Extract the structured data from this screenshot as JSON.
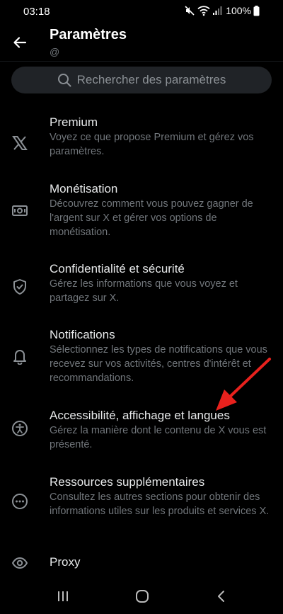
{
  "status_bar": {
    "time": "03:18",
    "battery": "100%"
  },
  "header": {
    "title": "Paramètres",
    "subtitle": "@"
  },
  "search": {
    "placeholder": "Rechercher des paramètres"
  },
  "settings": [
    {
      "icon": "x-logo-icon",
      "title": "Premium",
      "description": "Voyez ce que propose Premium et gérez vos paramètres."
    },
    {
      "icon": "money-icon",
      "title": "Monétisation",
      "description": "Découvrez comment vous pouvez gagner de l'argent sur X et gérer vos options de monétisation."
    },
    {
      "icon": "shield-check-icon",
      "title": "Confidentialité et sécurité",
      "description": "Gérez les informations que vous voyez et partagez sur X."
    },
    {
      "icon": "bell-icon",
      "title": "Notifications",
      "description": "Sélectionnez les types de notifications que vous recevez sur vos activités, centres d'intérêt et recommandations."
    },
    {
      "icon": "accessibility-icon",
      "title": "Accessibilité, affichage et langues",
      "description": "Gérez la manière dont le contenu de X vous est présenté."
    },
    {
      "icon": "more-circle-icon",
      "title": "Ressources supplémentaires",
      "description": "Consultez les autres sections pour obtenir des informations utiles sur les produits et services X."
    },
    {
      "icon": "eye-icon",
      "title": "Proxy",
      "description": ""
    }
  ],
  "colors": {
    "background": "#000000",
    "text_primary": "#e7e9ea",
    "text_secondary": "#71767b",
    "search_bg": "#202327",
    "annotation_arrow": "#e8211d"
  }
}
